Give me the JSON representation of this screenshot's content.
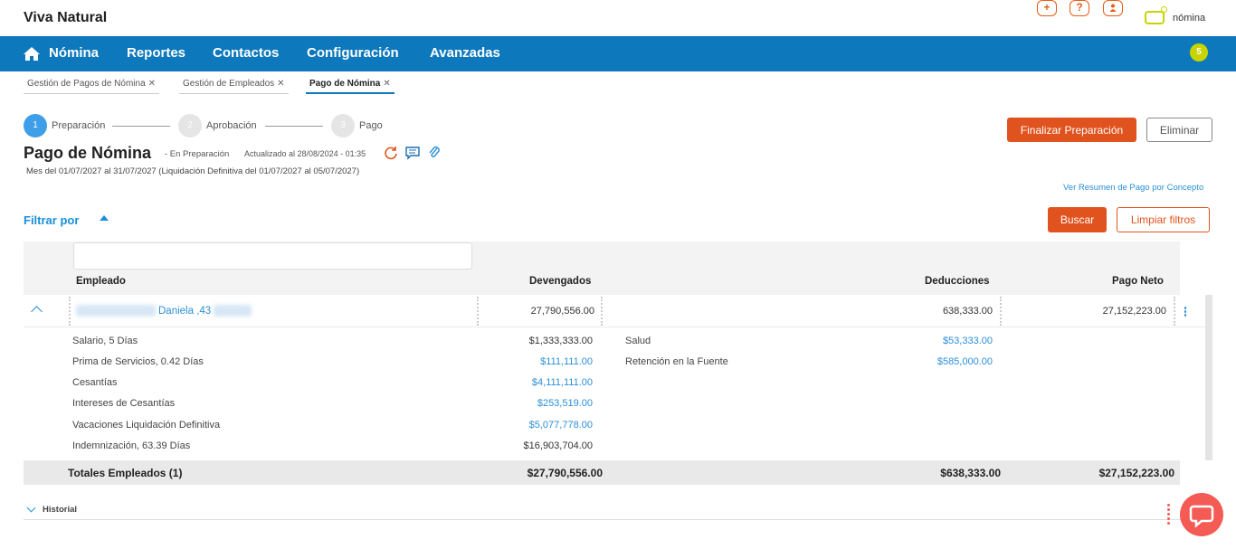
{
  "header": {
    "brand": "Viva Natural",
    "logo_text": "nómina"
  },
  "nav": {
    "items": [
      "Nómina",
      "Reportes",
      "Contactos",
      "Configuración",
      "Avanzadas"
    ],
    "notification_count": "5"
  },
  "tabs": [
    {
      "label": "Gestión de Pagos de Nómina"
    },
    {
      "label": "Gestión de Empleados"
    },
    {
      "label": "Pago de Nómina"
    }
  ],
  "stepper": [
    {
      "num": "1",
      "label": "Preparación"
    },
    {
      "num": "2",
      "label": "Aprobación"
    },
    {
      "num": "3",
      "label": "Pago"
    }
  ],
  "page": {
    "title": "Pago de Nómina",
    "status": "- En Preparación",
    "updated": "Actualizado al 28/08/2024 - 01:35",
    "subtitle": "Mes del 01/07/2027 al 31/07/2027 (Liquidación Definitiva del 01/07/2027 al 05/07/2027)"
  },
  "actions": {
    "finalize": "Finalizar Preparación",
    "delete": "Eliminar",
    "summary_link": "Ver Resumen de Pago por Concepto",
    "search": "Buscar",
    "clear": "Limpiar filtros"
  },
  "filter": {
    "label": "Filtrar por"
  },
  "table": {
    "headers": {
      "employee": "Empleado",
      "earnings": "Devengados",
      "deductions": "Deducciones",
      "net": "Pago Neto"
    },
    "row": {
      "employee": "Daniela ,43",
      "earnings": "27,790,556.00",
      "deductions": "638,333.00",
      "net": "27,152,223.00"
    },
    "earnings_details": [
      {
        "label": "Salario, 5 Días",
        "value": "$1,333,333.00",
        "link": false
      },
      {
        "label": "Prima de Servicios, 0.42 Días",
        "value": "$111,111.00",
        "link": true
      },
      {
        "label": "Cesantías",
        "value": "$4,111,111.00",
        "link": true
      },
      {
        "label": "Intereses de Cesantías",
        "value": "$253,519.00",
        "link": true
      },
      {
        "label": "Vacaciones Liquidación Definitiva",
        "value": "$5,077,778.00",
        "link": true
      },
      {
        "label": "Indemnización, 63.39 Días",
        "value": "$16,903,704.00",
        "link": false
      }
    ],
    "deductions_details": [
      {
        "label": "Salud",
        "value": "$53,333.00",
        "link": true
      },
      {
        "label": "Retención en la Fuente",
        "value": "$585,000.00",
        "link": true
      }
    ],
    "totals": {
      "label": "Totales Empleados (1)",
      "earnings": "$27,790,556.00",
      "deductions": "$638,333.00",
      "net": "$27,152,223.00"
    }
  },
  "historial": {
    "label": "Historial"
  },
  "colors": {
    "nav_bg": "#0d78bc",
    "accent_orange": "#e0531e",
    "link_blue": "#2a8fd8",
    "logo_lime": "#c8d400"
  }
}
